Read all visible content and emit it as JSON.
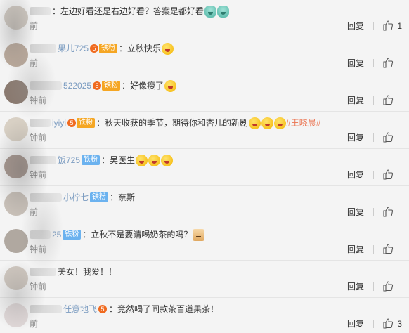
{
  "reply_label": "回复",
  "comments": [
    {
      "name": "",
      "badge": null,
      "text": "：左边好看还是右边好看？答案是都好看",
      "emojis": [
        "bowl",
        "bowl"
      ],
      "topic": "",
      "time": "前",
      "like_count": "1"
    },
    {
      "name": "果儿725",
      "badge": {
        "level": "5",
        "label": "铁粉",
        "style": "orange"
      },
      "text": "：立秋快乐",
      "emojis": [
        "face"
      ],
      "topic": "",
      "time": "前",
      "like_count": ""
    },
    {
      "name": "522025",
      "badge": {
        "level": "5",
        "label": "铁粉",
        "style": "orange"
      },
      "text": "：好像瘦了",
      "emojis": [
        "face"
      ],
      "topic": "",
      "time": "钟前",
      "like_count": ""
    },
    {
      "name": "iyiyi",
      "badge": {
        "level": "5",
        "label": "铁粉",
        "style": "orange"
      },
      "text": "：秋天收获的季节，期待你和杏儿的新剧",
      "emojis": [
        "face",
        "face",
        "face"
      ],
      "topic": "#王晓晨#",
      "time": "钟前",
      "like_count": ""
    },
    {
      "name": "饭725",
      "badge": {
        "level": "",
        "label": "铁粉",
        "style": "blue"
      },
      "text": "：吴医生",
      "emojis": [
        "face",
        "face",
        "face"
      ],
      "topic": "",
      "time": "钟前",
      "like_count": ""
    },
    {
      "name": "小柠七",
      "badge": {
        "level": "",
        "label": "铁粉",
        "style": "blue"
      },
      "text": "：奈斯",
      "emojis": [],
      "topic": "",
      "time": "前",
      "like_count": ""
    },
    {
      "name": "25",
      "badge": {
        "level": "",
        "label": "铁粉",
        "style": "blue"
      },
      "text": "：立秋不是要请喝奶茶的吗？",
      "emojis": [
        "cat"
      ],
      "topic": "",
      "time": "钟前",
      "like_count": ""
    },
    {
      "name": "",
      "badge": null,
      "text": "美女！我爱！！",
      "emojis": [],
      "topic": "",
      "time": "钟前",
      "like_count": ""
    },
    {
      "name": "任意地飞",
      "badge": {
        "level": "5",
        "label": "",
        "style": "orange"
      },
      "text": "：竟然喝了同款茶百道果茶！",
      "emojis": [],
      "topic": "",
      "time": "前",
      "like_count": "3"
    }
  ]
}
